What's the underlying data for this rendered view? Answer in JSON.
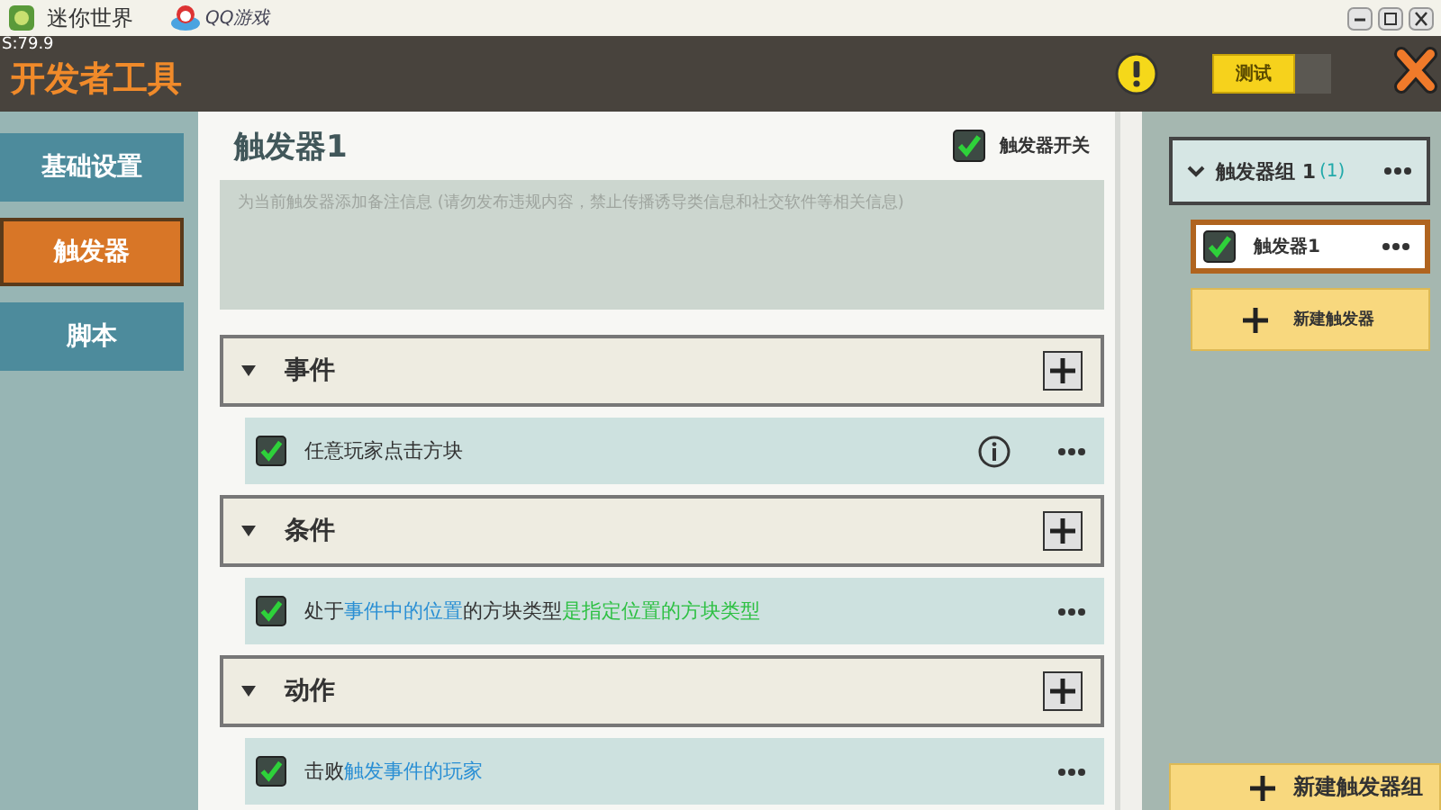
{
  "window": {
    "title": "迷你世界",
    "logo_text": "QQ游戏"
  },
  "header": {
    "fps": "S:79.9",
    "title": "开发者工具",
    "test_button": "测试",
    "test_toggle_on": false
  },
  "sidebar": {
    "items": [
      {
        "label": "基础设置",
        "selected": false
      },
      {
        "label": "触发器",
        "selected": true
      },
      {
        "label": "脚本",
        "selected": false
      }
    ]
  },
  "trigger": {
    "name": "触发器1",
    "switch_label": "触发器开关",
    "switch_checked": true,
    "note_placeholder": "为当前触发器添加备注信息 (请勿发布违规内容，禁止传播诱导类信息和社交软件等相关信息)"
  },
  "sections": [
    {
      "title": "事件",
      "expanded": true,
      "items": [
        {
          "checked": true,
          "info": true,
          "parts": [
            {
              "kind": "plain",
              "text": "任意玩家点击方块"
            }
          ]
        }
      ]
    },
    {
      "title": "条件",
      "expanded": true,
      "items": [
        {
          "checked": true,
          "info": false,
          "parts": [
            {
              "kind": "plain",
              "text": "处于"
            },
            {
              "kind": "event",
              "text": "事件中的位置"
            },
            {
              "kind": "plain",
              "text": "的方块类型"
            },
            {
              "kind": "value",
              "text": "是指定位置的方块类型"
            }
          ]
        }
      ]
    },
    {
      "title": "动作",
      "expanded": true,
      "items": [
        {
          "checked": true,
          "info": false,
          "parts": [
            {
              "kind": "plain",
              "text": "击败"
            },
            {
              "kind": "event",
              "text": "触发事件的玩家"
            }
          ]
        }
      ]
    }
  ],
  "groups": [
    {
      "title": "触发器组 1",
      "count": "(1)",
      "expanded": true,
      "triggers": [
        {
          "name": "触发器1",
          "checked": true,
          "selected": true
        }
      ],
      "new_trigger": "新建触发器"
    }
  ],
  "new_group": "新建触发器组"
}
